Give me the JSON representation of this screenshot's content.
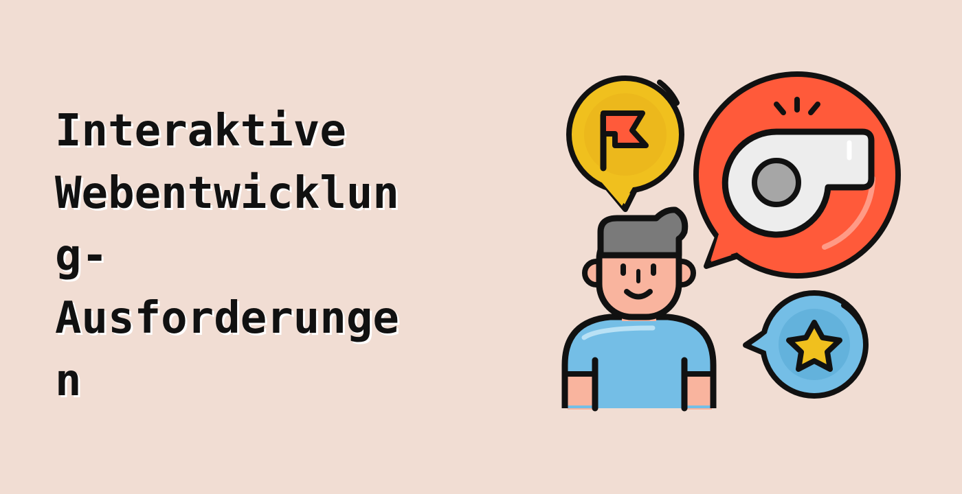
{
  "banner": {
    "title_lines": [
      "Interaktive",
      "Webentwicklun",
      "g-",
      "Ausforderunge",
      "n"
    ]
  },
  "illustration": {
    "icons": [
      "flag-icon",
      "whistle-icon",
      "star-icon",
      "person-icon"
    ],
    "colors": {
      "background": "#F1DDD3",
      "flag_bubble": "#F0C01E",
      "whistle_bubble": "#FF5A3A",
      "star_bubble": "#74BEE6",
      "star": "#F0C01E",
      "shirt": "#74BEE6",
      "skin": "#F9B49E",
      "hair": "#7A7A7A",
      "outline": "#111111"
    }
  }
}
